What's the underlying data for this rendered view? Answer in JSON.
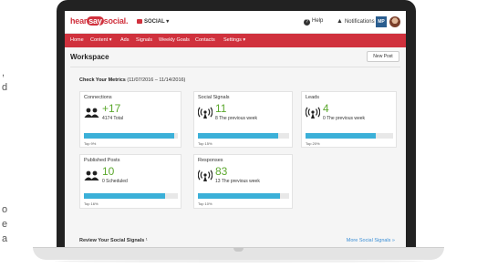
{
  "page_fragments": [
    ",",
    "d",
    "o",
    "e",
    "a"
  ],
  "app": {
    "logo_parts": [
      "hear",
      "say",
      "social."
    ],
    "account_selector": "SOCIAL ▾",
    "help_label": "Help",
    "notifications_label": "Notifications",
    "account_badge": "MP"
  },
  "nav": {
    "items": [
      "Home",
      "Content ▾",
      "Ads",
      "Signals",
      "Weekly Goals",
      "Contacts",
      "Settings ▾"
    ]
  },
  "workspace": {
    "title": "Workspace",
    "new_post_label": "New Post",
    "metrics_title": "Check Your Metrics",
    "metrics_range": " (11/07/2016 – 11/14/2016)"
  },
  "cards": [
    {
      "title": "Connections",
      "big": "+17",
      "sub": "4174 Total",
      "top": "Top 9%",
      "fill": 0.96,
      "icon": "people-icon"
    },
    {
      "title": "Social Signals",
      "big": "11",
      "sub": "8 The previous week",
      "top": "Top 15%",
      "fill": 0.88,
      "icon": "signal-icon"
    },
    {
      "title": "Leads",
      "big": "4",
      "sub": "0 The previous week",
      "top": "Top 20%",
      "fill": 0.8,
      "icon": "signal-icon"
    },
    {
      "title": "Published Posts",
      "big": "10",
      "sub": "0 Scheduled",
      "top": "Top 16%",
      "fill": 0.86,
      "icon": "people-icon"
    },
    {
      "title": "Responses",
      "big": "83",
      "sub": "13 The previous week",
      "top": "Top 10%",
      "fill": 0.9,
      "icon": "signal-icon"
    }
  ],
  "review": {
    "title": "Review Your Social Signals",
    "info_mark": "¹",
    "more_link": "More Social Signals »"
  },
  "colors": {
    "brand_red": "#d0313d",
    "metric_green": "#5ca82e",
    "bar_blue": "#3bb0d8"
  }
}
